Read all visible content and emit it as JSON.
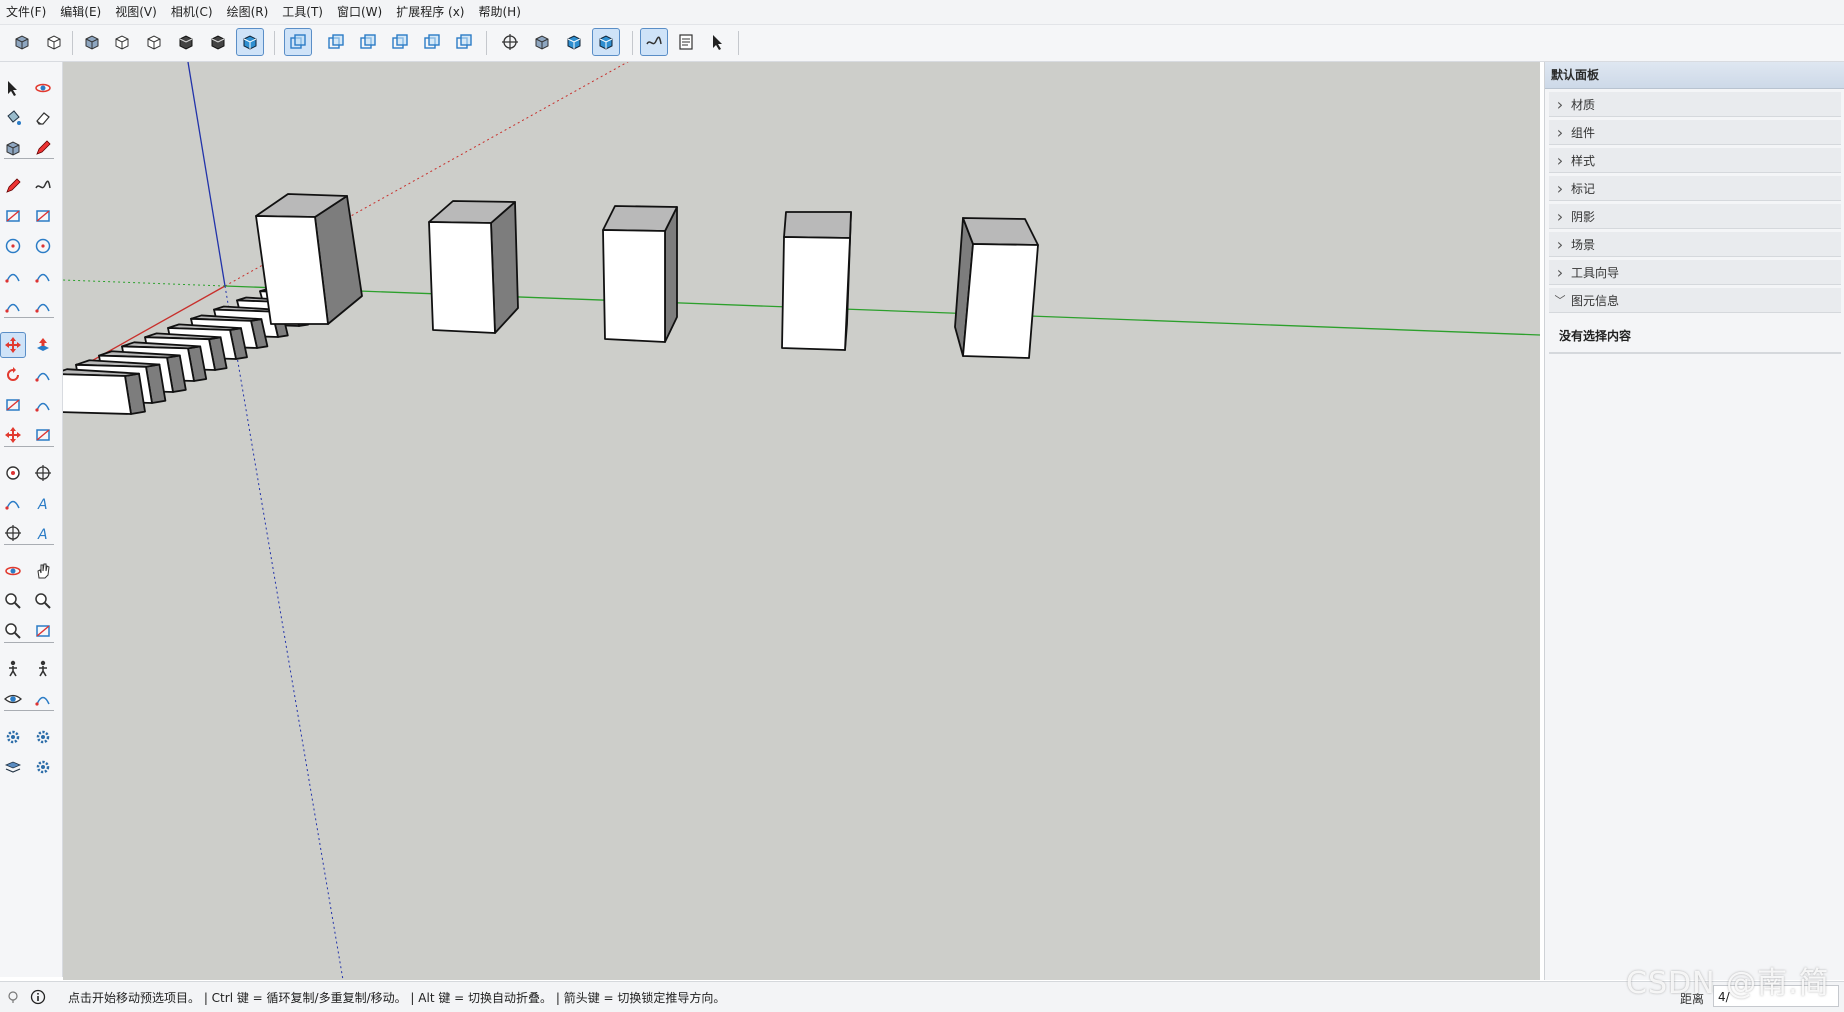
{
  "menu": [
    "文件(F)",
    "编辑(E)",
    "视图(V)",
    "相机(C)",
    "绘图(R)",
    "工具(T)",
    "窗口(W)",
    "扩展程序 (x)",
    "帮助(H)"
  ],
  "toolbar": {
    "buttons": [
      "iso-view",
      "top-view",
      "front-view",
      "right-view",
      "back-view",
      "left-view",
      "xray",
      "back-edges",
      "wireframe",
      "hidden-line",
      "shaded",
      "shaded-with-textures",
      "monochrome",
      "section-plane",
      "outer-shell",
      "intersect",
      "union",
      "subtract",
      "trim",
      "split",
      "position-camera",
      "look-around",
      "walk",
      "sandbox-smoove",
      "sandbox-stamp",
      "sandbox-drape",
      "component-options",
      "component-attributes",
      "generate-report",
      "dynamic-components"
    ],
    "active": [
      "shaded",
      "shaded-with-textures",
      "sandbox-smoove",
      "sandbox-stamp"
    ]
  },
  "left_tools": {
    "rows": [
      [
        "select-arrow",
        "lasso-select"
      ],
      [
        "paint-bucket",
        "eraser"
      ],
      [
        "make-component",
        "tag-tool"
      ],
      [
        "pencil-line",
        "freehand"
      ],
      [
        "rectangle",
        "rotated-rectangle"
      ],
      [
        "circle",
        "polygon"
      ],
      [
        "arc",
        "2pt-arc"
      ],
      [
        "3pt-arc",
        "pie"
      ],
      [
        "move",
        "push-pull"
      ],
      [
        "rotate",
        "follow-me"
      ],
      [
        "scale",
        "offset"
      ],
      [
        "axes",
        "section-plane"
      ],
      [
        "tape-measure",
        "dimension"
      ],
      [
        "protractor",
        "text-label"
      ],
      [
        "axes-tool",
        "3d-text"
      ],
      [
        "orbit",
        "pan"
      ],
      [
        "zoom",
        "zoom-window"
      ],
      [
        "zoom-extents",
        "previous-view"
      ],
      [
        "position-camera",
        "walk"
      ],
      [
        "look-around",
        "section-fill"
      ],
      [
        "solid-tools",
        "sandbox"
      ],
      [
        "layers",
        "sandbox-settings"
      ]
    ],
    "active": [
      "move"
    ]
  },
  "tray": {
    "title": "默认面板",
    "sections": [
      "材质",
      "组件",
      "样式",
      "标记",
      "阴影",
      "场景",
      "工具向导"
    ],
    "expanded_section": "图元信息",
    "entity_info_text": "没有选择内容"
  },
  "status": {
    "hint": "点击开始移动预选项目。 | Ctrl 键 = 循环复制/多重复制/移动。 | Alt 键 = 切换自动折叠。 | 箭头键 = 切换锁定推导方向。",
    "measure_label": "距离",
    "measure_value": "4/"
  },
  "watermark": "CSDN @南.简",
  "colors": {
    "viewport_bg": "#cdceca",
    "axis_red": "#c8302c",
    "axis_green": "#2ca02c",
    "axis_blue": "#2233aa",
    "face_white": "#ffffff",
    "face_dark": "#7d7d7d",
    "face_top": "#b9b9b9",
    "active_button": "#cfe3f8"
  }
}
